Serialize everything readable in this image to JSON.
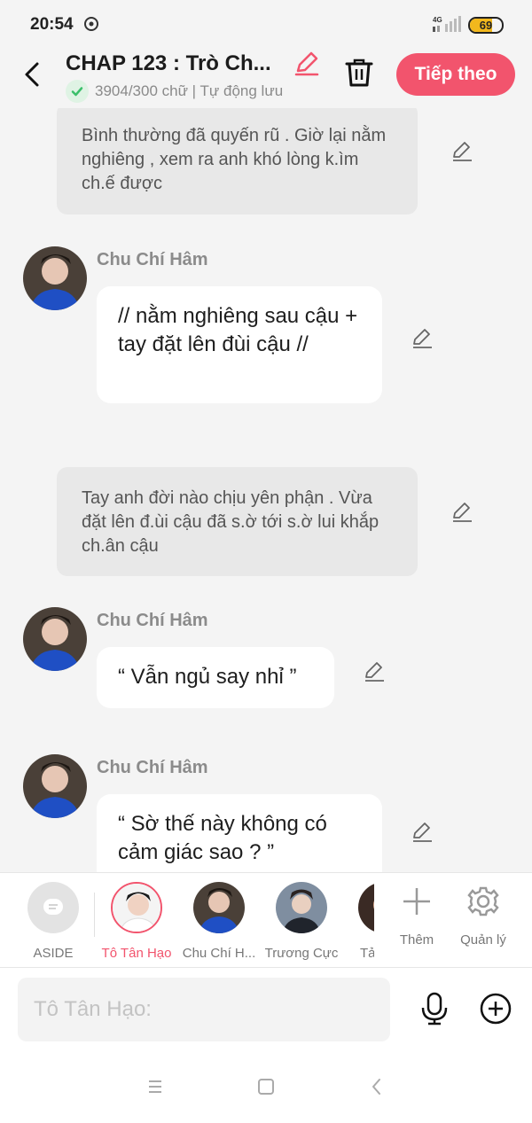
{
  "status_bar": {
    "time": "20:54",
    "network": "4G",
    "battery": "69",
    "battery_level": 0.69
  },
  "header": {
    "title": "CHAP 123 : Trò Ch...",
    "subtitle": "3904/300 chữ | Tự động lưu",
    "next_label": "Tiếp theo"
  },
  "chat": {
    "aside_1": "Bình thường đã quyến rũ . Giờ lại nằm nghiêng , xem ra anh khó lòng k.ìm ch.ế được",
    "msg_1": {
      "name": "Chu Chí Hâm",
      "text": "// nằm nghiêng sau cậu + tay đặt lên đùi cậu //"
    },
    "aside_2": "Tay anh đời nào chịu yên phận . Vừa đặt lên đ.ùi cậu đã s.ờ tới s.ờ lui khắp ch.ân cậu",
    "msg_2": {
      "name": "Chu Chí Hâm",
      "text": "“ Vẫn ngủ say nhỉ ”"
    },
    "msg_3": {
      "name": "Chu Chí Hâm",
      "text": "“ Sờ thế này không có cảm giác sao ? ”"
    }
  },
  "characters": {
    "aside": "ASIDE",
    "c1": "Tô Tân Hạo",
    "c2": "Chu Chí H...",
    "c3": "Trương Cực",
    "c4": "Tả",
    "add": "Thêm",
    "manage": "Quản lý"
  },
  "input": {
    "placeholder": "Tô Tân Hạo:"
  },
  "colors": {
    "accent": "#f2546d",
    "check": "#3bbf6a"
  }
}
